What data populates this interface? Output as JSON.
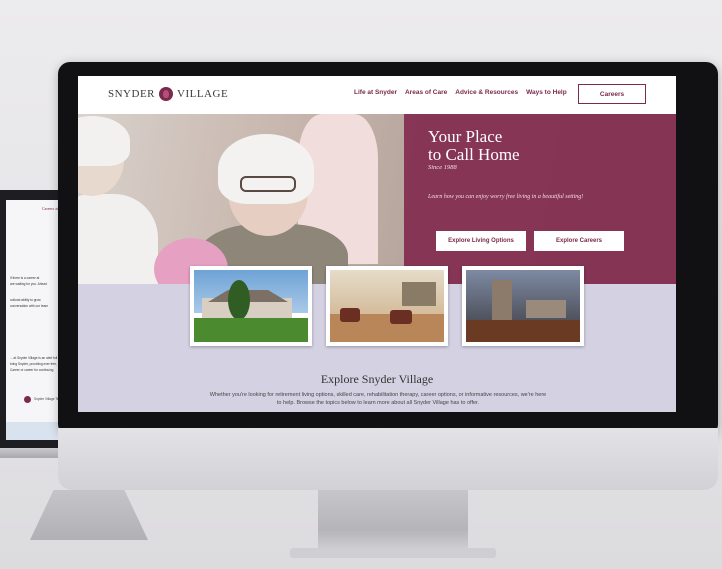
{
  "laptop": {
    "title": "Careers at",
    "lines": [
      "If there is a career at",
      "are waiting for you. Ahead",
      "",
      "cultural ability to grow",
      "conversation with our team",
      "",
      "... at Snyder Village is an alert full",
      "bring Snyder, providing exer free, a",
      "Career or career for continuing",
      ""
    ],
    "footer_logo_text": "Snyder Village Tea"
  },
  "site": {
    "logo_left": "SNYDER",
    "logo_right": "VILLAGE",
    "nav": [
      "Life at Snyder",
      "Areas of Care",
      "Advice & Resources",
      "Ways to Help"
    ],
    "careers_button": "Careers",
    "hero": {
      "title_line1": "Your Place",
      "title_line2": "to Call Home",
      "since": "Since 1988",
      "tagline": "Learn how you can enjoy worry free living in a beautiful setting!",
      "btn_living": "Explore Living Options",
      "btn_careers": "Explore Careers"
    },
    "explore": {
      "title": "Explore Snyder Village",
      "text": "Whether you're looking for retirement living options, skilled care, rehabilitation therapy, career options, or informative resources, we're here to help. Browse the topics below to learn more about all Snyder Village has to offer."
    }
  },
  "colors": {
    "brand": "#7a2a4c",
    "overlay": "#80254b",
    "lavender": "#d4d2e2"
  }
}
